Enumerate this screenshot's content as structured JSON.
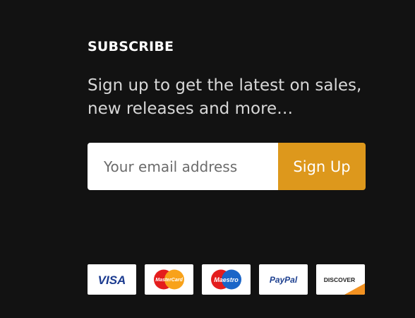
{
  "subscribe": {
    "heading": "SUBSCRIBE",
    "blurb": "Sign up to get the latest on sales, new releases and more…",
    "email_placeholder": "Your email address",
    "signup_label": "Sign Up",
    "accent_color": "#dd981c"
  },
  "payments": {
    "cards": [
      {
        "icon": "visa-icon",
        "text": "VISA"
      },
      {
        "icon": "mastercard-icon",
        "text": "MasterCard"
      },
      {
        "icon": "maestro-icon",
        "text": "Maestro"
      },
      {
        "icon": "paypal-icon",
        "text": "PayPal"
      },
      {
        "icon": "discover-icon",
        "text": "DISCOVER"
      }
    ]
  }
}
